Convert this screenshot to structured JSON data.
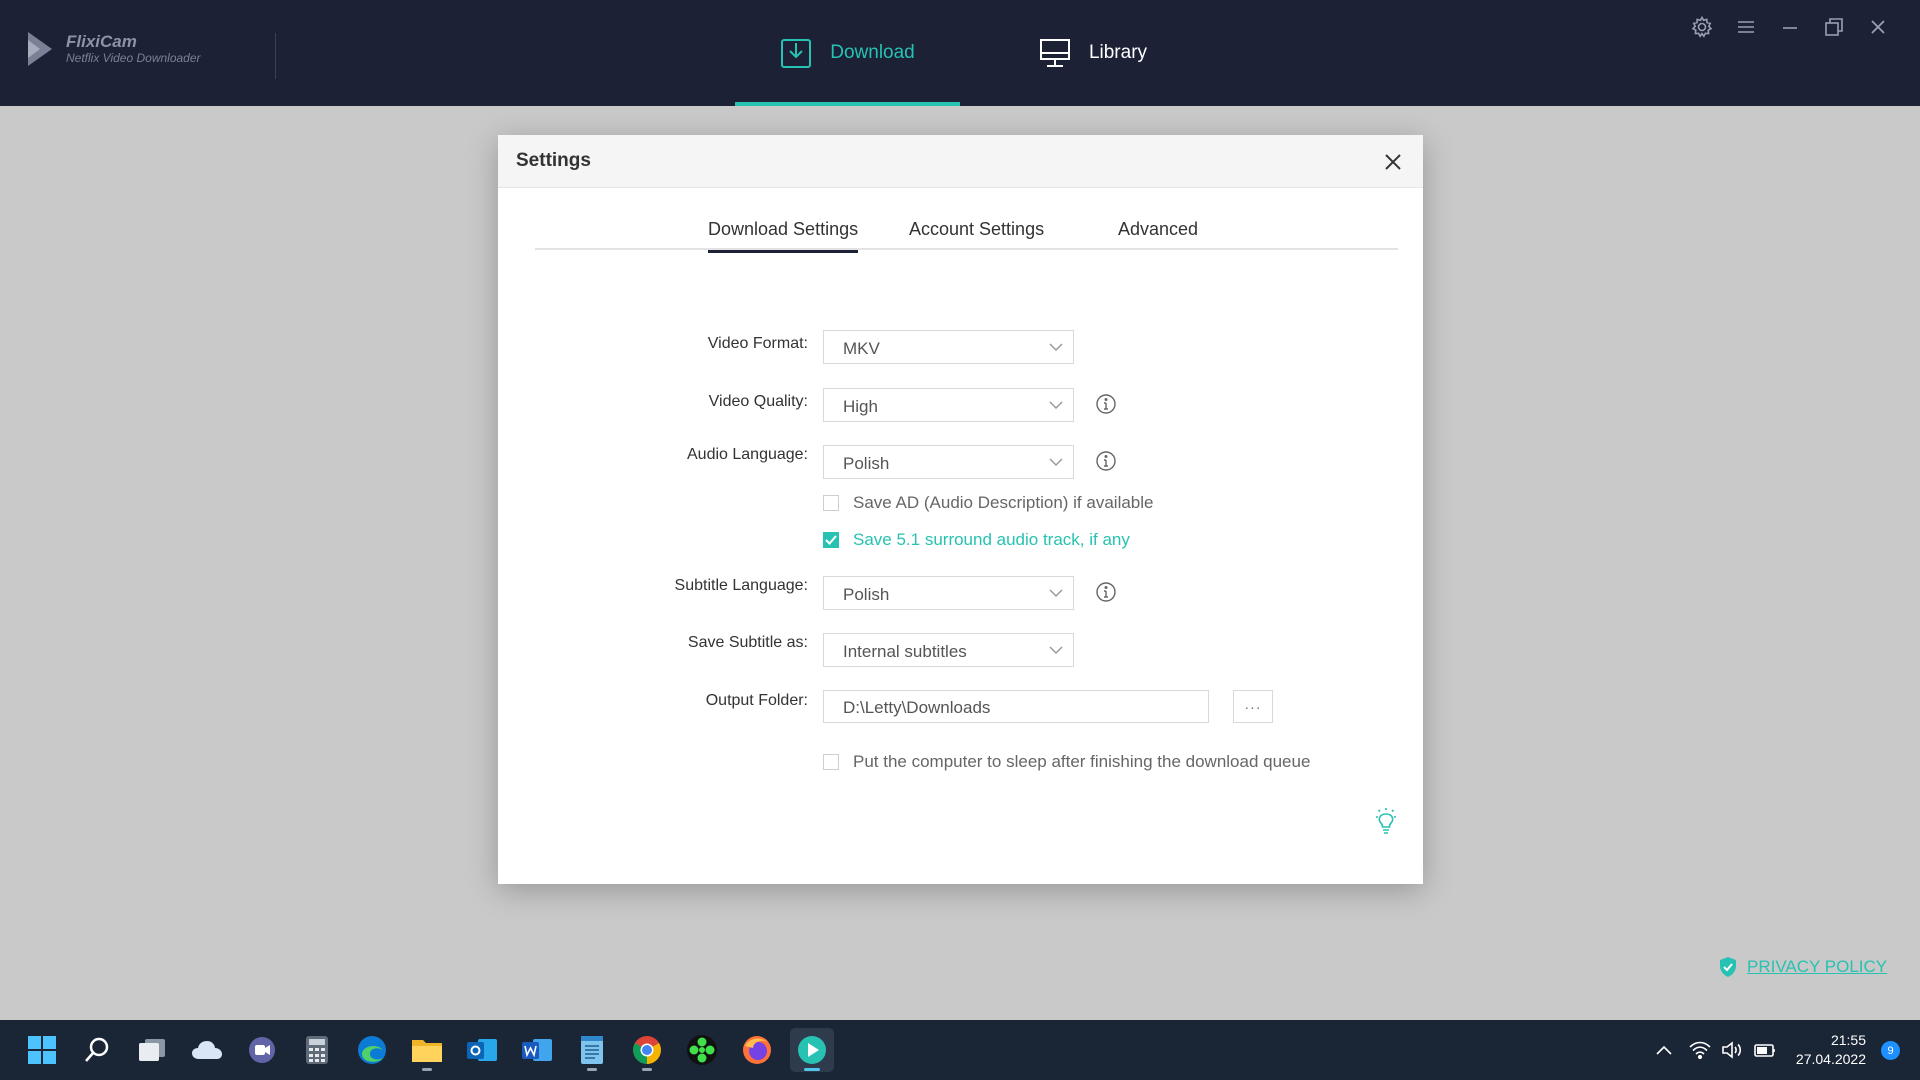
{
  "app": {
    "name": "FlixiCam",
    "subtitle": "Netflix Video Downloader",
    "accent_color": "#27c2b1",
    "header_color": "#1c2136"
  },
  "nav": {
    "download_label": "Download",
    "library_label": "Library",
    "active": "Download"
  },
  "window_controls": [
    "gear-icon",
    "menu-icon",
    "minimize-icon",
    "restore-icon",
    "close-icon"
  ],
  "settings": {
    "title": "Settings",
    "tabs": [
      {
        "label": "Download Settings",
        "active": true
      },
      {
        "label": "Account Settings",
        "active": false
      },
      {
        "label": "Advanced",
        "active": false
      }
    ],
    "video_format": {
      "label": "Video Format:",
      "value": "MKV"
    },
    "video_quality": {
      "label": "Video Quality:",
      "value": "High"
    },
    "audio_language": {
      "label": "Audio Language:",
      "value": "Polish"
    },
    "save_ad": {
      "label": "Save AD (Audio Description) if available",
      "checked": false
    },
    "save_51": {
      "label": "Save 5.1 surround audio track, if any",
      "checked": true
    },
    "subtitle_language": {
      "label": "Subtitle Language:",
      "value": "Polish"
    },
    "save_subtitle_as": {
      "label": "Save Subtitle as:",
      "value": "Internal subtitles"
    },
    "output_folder": {
      "label": "Output Folder:",
      "value": "D:\\Letty\\Downloads",
      "browse_label": "···"
    },
    "sleep": {
      "label": "Put the computer to sleep after finishing the download queue",
      "checked": false
    }
  },
  "privacy": {
    "label": "PRIVACY POLICY"
  },
  "taskbar": {
    "apps": [
      "windows-start-icon",
      "search-icon",
      "task-view-icon",
      "onedrive-icon",
      "teams-chat-icon",
      "calculator-icon",
      "edge-icon",
      "file-explorer-icon",
      "outlook-icon",
      "word-icon",
      "notepad-icon",
      "chrome-icon",
      "cinema-app-icon",
      "firefox-icon",
      "flixicam-icon"
    ],
    "time": "21:55",
    "date": "27.04.2022",
    "notification_count": "9"
  }
}
